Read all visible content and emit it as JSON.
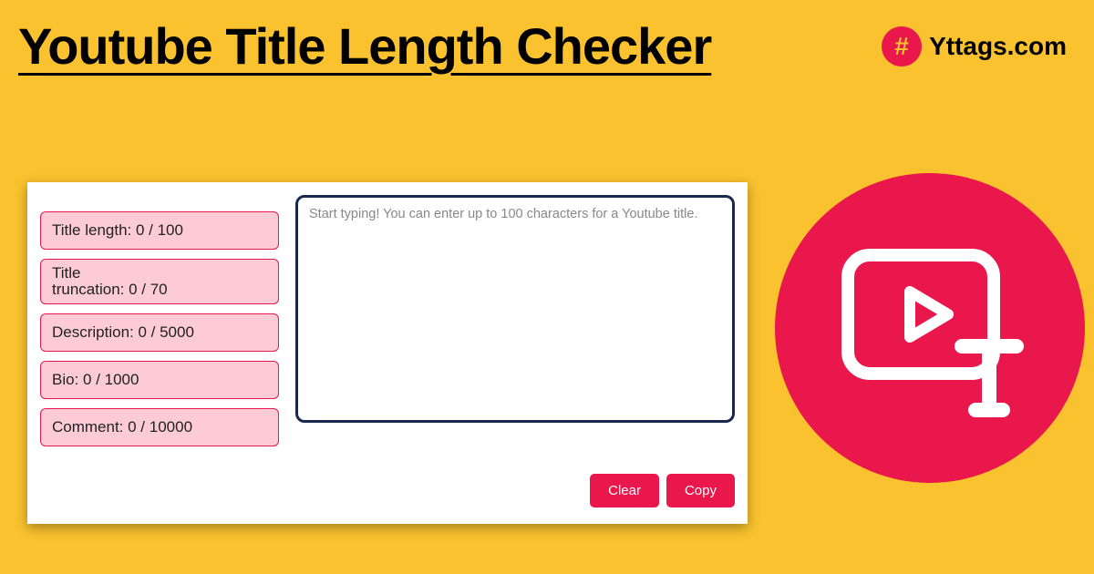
{
  "header": {
    "title": "Youtube Title Length Checker",
    "brand": "Yttags.com"
  },
  "counters": {
    "title_length": "Title length: 0 / 100",
    "title_truncation_l1": "Title",
    "title_truncation_l2": "truncation: 0 / 70",
    "description": "Description: 0 / 5000",
    "bio": "Bio: 0 / 1000",
    "comment": "Comment: 0 / 10000"
  },
  "input": {
    "placeholder": "Start typing! You can enter up to 100 characters for a Youtube title."
  },
  "buttons": {
    "clear": "Clear",
    "copy": "Copy"
  },
  "colors": {
    "accent": "#E9174B",
    "bg": "#F9C22E",
    "counter_bg": "#FCCBD5",
    "textarea_border": "#1a2850"
  }
}
